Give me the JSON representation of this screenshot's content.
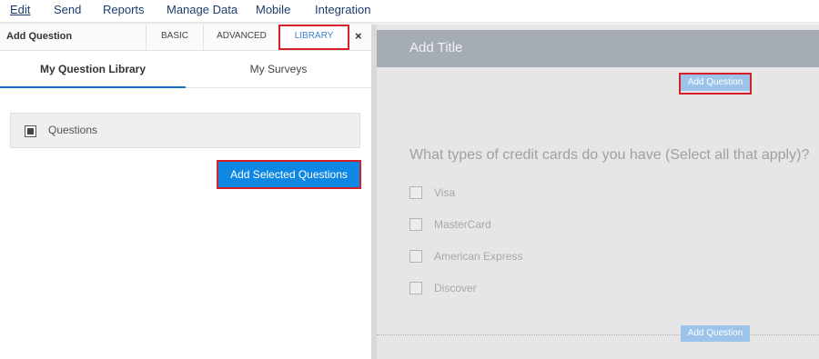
{
  "menu": {
    "items": [
      "Edit",
      "Send",
      "Reports",
      "Manage Data",
      "Mobile",
      "Integration"
    ]
  },
  "panel": {
    "title": "Add Question",
    "tabs": [
      "BASIC",
      "ADVANCED",
      "LIBRARY"
    ],
    "close_icon": "×",
    "subtabs": [
      "My Question Library",
      "My Surveys"
    ],
    "library_item": "Questions",
    "add_selected_label": "Add Selected Questions"
  },
  "survey": {
    "title_placeholder": "Add Title",
    "add_question_label": "Add Question",
    "question": "What types of credit cards do you have (Select all that apply)?",
    "options": [
      "Visa",
      "MasterCard",
      "American Express",
      "Discover"
    ]
  },
  "colors": {
    "highlight": "#d42127",
    "primary_button": "#0e88e2",
    "menu_text": "#1b3e6e"
  }
}
